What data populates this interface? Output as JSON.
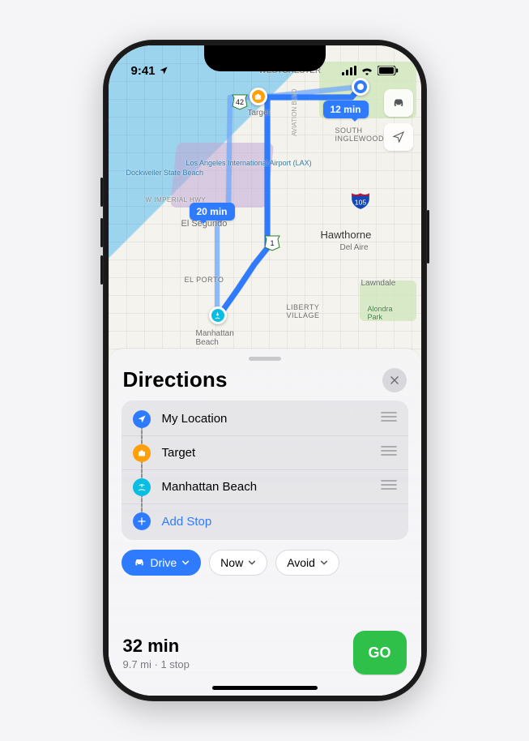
{
  "statusbar": {
    "time": "9:41"
  },
  "map": {
    "labels": {
      "westchester": "WESTCHESTER",
      "south_inglewood": "SOUTH\nINGLEWOOD",
      "aviation_blvd": "AVIATION BLVD",
      "dockweiler": "Dockweiler State Beach",
      "lax": "Los Angeles International Airport (LAX)",
      "imperial_hwy": "W IMPERIAL HWY",
      "el_segundo": "El Segundo",
      "hawthorne": "Hawthorne",
      "del_aire": "Del Aire",
      "el_porto": "EL PORTO",
      "liberty_village": "LIBERTY\nVILLAGE",
      "lawndale": "Lawndale",
      "alondra_park": "Alondra\nPark",
      "manhattan_beach": "Manhattan\nBeach",
      "target_pin": "Target"
    },
    "route_etas": {
      "primary": "12 min",
      "alternate": "20 min"
    },
    "shields": {
      "ca1": "1",
      "ca42": "42",
      "i105": "105"
    }
  },
  "sheet": {
    "title": "Directions",
    "stops": [
      {
        "label": "My Location",
        "kind": "origin"
      },
      {
        "label": "Target",
        "kind": "stop"
      },
      {
        "label": "Manhattan Beach",
        "kind": "destination"
      }
    ],
    "add_stop_label": "Add Stop",
    "modes": {
      "drive": "Drive",
      "time": "Now",
      "avoid": "Avoid"
    },
    "summary": {
      "eta": "32 min",
      "sub": "9.7 mi · 1 stop"
    },
    "go_label": "GO"
  }
}
